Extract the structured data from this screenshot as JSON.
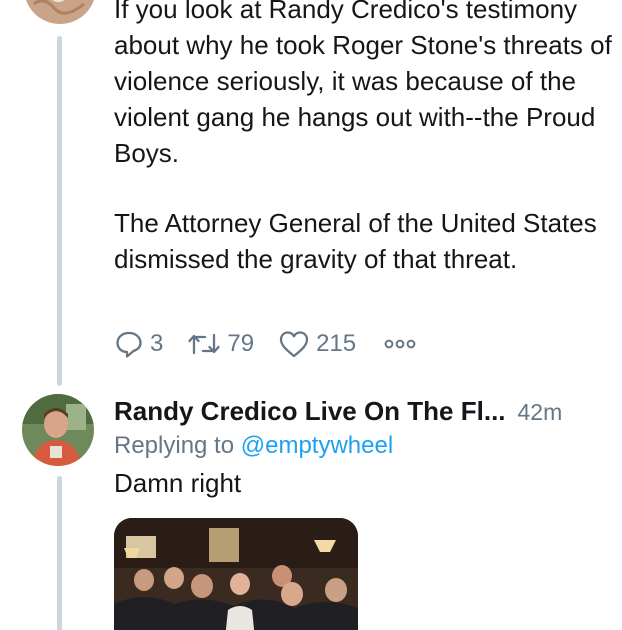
{
  "first_tweet": {
    "paragraphs": [
      "If you look at Randy Credico's testimony about why he took Roger Stone's threats of violence seriously, it was because of the violent gang he hangs out with--the Proud Boys.",
      "The Attorney General of the United States dismissed the gravity of that threat."
    ],
    "actions": {
      "replies": "3",
      "retweets": "79",
      "likes": "215"
    },
    "icons": [
      "reply-icon",
      "retweet-icon",
      "like-icon",
      "more-icon"
    ]
  },
  "reply_tweet": {
    "display_name": "Randy Credico Live On The Fl...",
    "timestamp": "42m",
    "replying_prefix": "Replying to",
    "replying_handle": "@emptywheel",
    "text": "Damn right"
  },
  "colors": {
    "text": "#14171a",
    "secondary": "#657786",
    "link": "#1da1f2",
    "thread_line": "#ccd6dd"
  }
}
